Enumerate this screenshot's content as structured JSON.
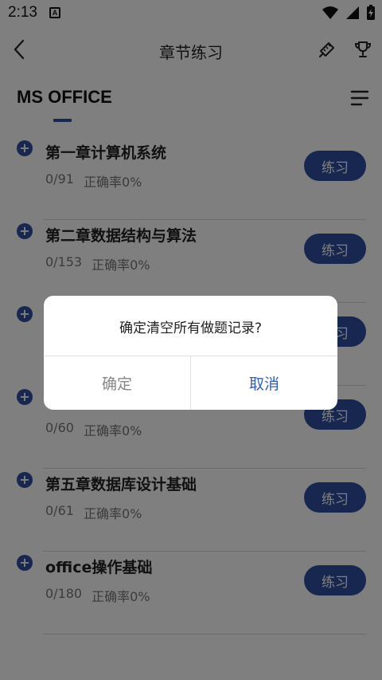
{
  "status_bar": {
    "time": "2:13",
    "notification_badge": "A"
  },
  "app_bar": {
    "title": "章节练习",
    "back_icon": "chevron-left-icon",
    "icons": [
      "pencil-ruler-icon",
      "trophy-icon"
    ]
  },
  "subject": {
    "title": "MS OFFICE",
    "accent_color": "#2f4fa0"
  },
  "chapters": [
    {
      "name": "第一章计算机系统",
      "progress": "0/91",
      "accuracy": "正确率0%",
      "button": "练习"
    },
    {
      "name": "第二章数据结构与算法",
      "progress": "0/153",
      "accuracy": "正确率0%",
      "button": "练习"
    },
    {
      "name": "",
      "progress": "",
      "accuracy": "",
      "button": "练习"
    },
    {
      "name": "",
      "progress": "0/60",
      "accuracy": "正确率0%",
      "button": "练习"
    },
    {
      "name": "第五章数据库设计基础",
      "progress": "0/61",
      "accuracy": "正确率0%",
      "button": "练习"
    },
    {
      "name": "office操作基础",
      "progress": "0/180",
      "accuracy": "正确率0%",
      "button": "练习"
    }
  ],
  "dialog": {
    "message": "确定清空所有做题记录?",
    "confirm_label": "确定",
    "cancel_label": "取消",
    "cancel_color": "#2f5fc4"
  }
}
